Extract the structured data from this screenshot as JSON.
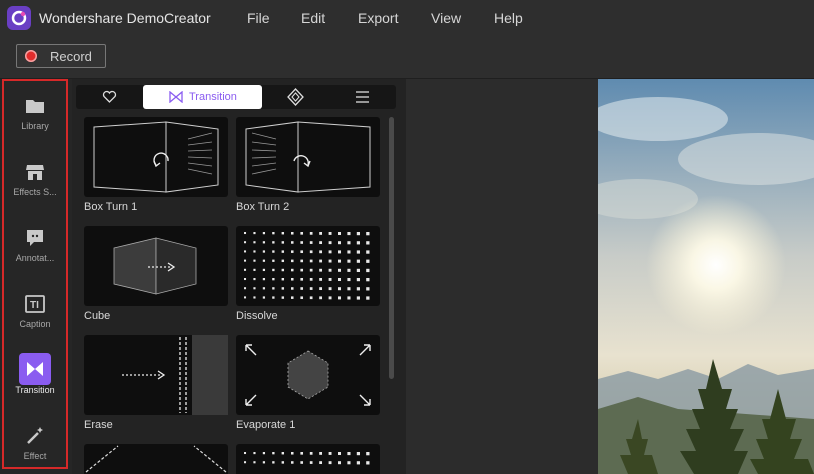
{
  "app": {
    "title": "Wondershare DemoCreator",
    "logo_icon": "democreator-logo"
  },
  "menu": [
    "File",
    "Edit",
    "Export",
    "View",
    "Help"
  ],
  "toolbar": {
    "record_label": "Record"
  },
  "sidebar": {
    "items": [
      {
        "label": "Library",
        "icon": "folder-icon",
        "active": false
      },
      {
        "label": "Effects S...",
        "icon": "store-icon",
        "active": false
      },
      {
        "label": "Annotat...",
        "icon": "speech-bubble-icon",
        "active": false
      },
      {
        "label": "Caption",
        "icon": "text-caption-icon",
        "active": false
      },
      {
        "label": "Transition",
        "icon": "transition-icon",
        "active": true
      },
      {
        "label": "Effect",
        "icon": "magic-wand-icon",
        "active": false
      }
    ],
    "highlight_color": "#d62929"
  },
  "tabs": {
    "items": [
      {
        "icon": "heart-icon",
        "label": ""
      },
      {
        "icon": "transition-icon",
        "label": "Transition",
        "active": true
      },
      {
        "icon": "diamond-icon",
        "label": ""
      },
      {
        "icon": "menu-icon",
        "label": ""
      }
    ]
  },
  "transitions": [
    {
      "label": "Box Turn 1",
      "icon": "box-turn-1-thumb"
    },
    {
      "label": "Box Turn 2",
      "icon": "box-turn-2-thumb"
    },
    {
      "label": "Cube",
      "icon": "cube-thumb"
    },
    {
      "label": "Dissolve",
      "icon": "dissolve-thumb"
    },
    {
      "label": "Erase",
      "icon": "erase-thumb"
    },
    {
      "label": "Evaporate 1",
      "icon": "evaporate-thumb"
    }
  ],
  "colors": {
    "accent": "#8a5cf0",
    "record": "#e22c2c"
  }
}
